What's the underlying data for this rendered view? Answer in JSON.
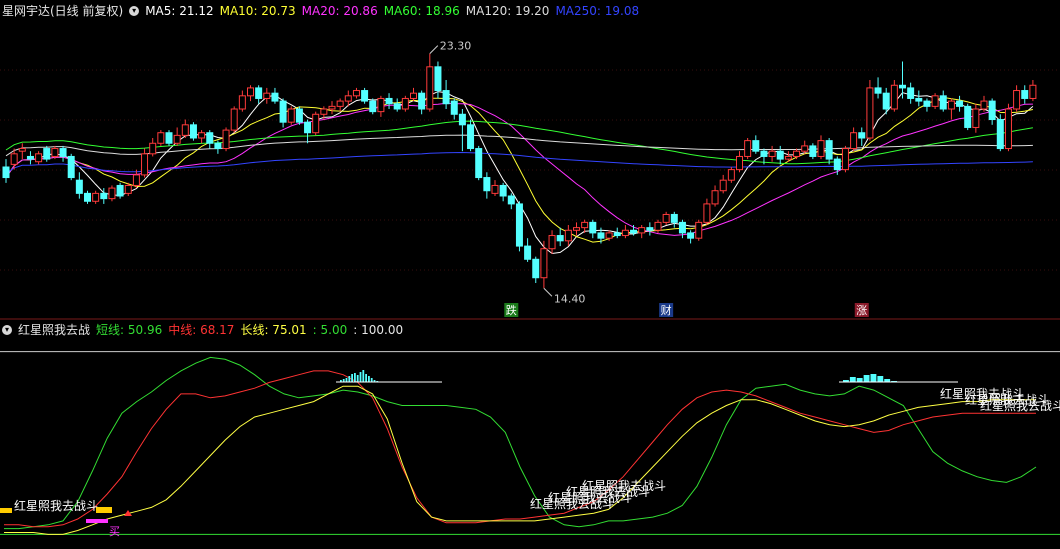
{
  "main_panel": {
    "title": "星网宇达(日线 前复权)",
    "toggle_icon": "chevron-down-icon",
    "indicators": [
      {
        "label": "MA5: 21.12",
        "color": "#ffffff"
      },
      {
        "label": "MA10: 20.73",
        "color": "#ffff33"
      },
      {
        "label": "MA20: 20.86",
        "color": "#ff33ff"
      },
      {
        "label": "MA60: 18.96",
        "color": "#33ff33"
      },
      {
        "label": "MA120: 19.20",
        "color": "#dcdcdc"
      },
      {
        "label": "MA250: 19.08",
        "color": "#3344ff"
      }
    ],
    "high_label": "23.30",
    "low_label": "14.40",
    "markers": [
      {
        "text": "跌",
        "bg": "#1a7a1a"
      },
      {
        "text": "财",
        "bg": "#1a3a8a"
      },
      {
        "text": "涨",
        "bg": "#8a1a2a"
      }
    ]
  },
  "sub_panel": {
    "title": "红星照我去战",
    "indicators": [
      {
        "label": "短线: 50.96",
        "color": "#33dd33"
      },
      {
        "label": "中线: 68.17",
        "color": "#ff3333"
      },
      {
        "label": "长线: 75.01",
        "color": "#ffff44"
      },
      {
        "label": ": 5.00",
        "color": "#33dd33"
      },
      {
        "label": ": 100.00",
        "color": "#e6e6e6"
      }
    ],
    "annotation": "红星照我去战斗",
    "buy_mark": "买"
  },
  "chart_data": [
    {
      "type": "candlestick",
      "title": "星网宇达(日线 前复权)",
      "ylim": [
        13.5,
        24.5
      ],
      "price_high": 23.3,
      "price_low": 14.4,
      "bars": [
        [
          19.0,
          18.6,
          19.3,
          18.4
        ],
        [
          19.1,
          19.5,
          19.7,
          18.9
        ],
        [
          19.6,
          19.7,
          19.9,
          19.3
        ],
        [
          19.4,
          19.3,
          19.6,
          19.1
        ],
        [
          19.2,
          19.5,
          19.6,
          19.1
        ],
        [
          19.7,
          19.3,
          19.8,
          19.2
        ],
        [
          19.4,
          19.7,
          19.8,
          19.3
        ],
        [
          19.7,
          19.4,
          19.8,
          19.2
        ],
        [
          19.4,
          18.6,
          19.5,
          18.5
        ],
        [
          18.5,
          18.0,
          18.8,
          17.8
        ],
        [
          18.0,
          17.7,
          18.1,
          17.6
        ],
        [
          17.7,
          18.0,
          18.1,
          17.6
        ],
        [
          18.0,
          17.8,
          18.2,
          17.6
        ],
        [
          17.8,
          18.2,
          18.3,
          17.7
        ],
        [
          18.3,
          17.9,
          18.4,
          17.8
        ],
        [
          18.0,
          18.3,
          18.4,
          17.9
        ],
        [
          18.3,
          18.7,
          18.9,
          18.2
        ],
        [
          18.7,
          19.5,
          19.7,
          18.6
        ],
        [
          19.5,
          19.9,
          20.1,
          19.4
        ],
        [
          19.9,
          20.3,
          20.4,
          19.8
        ],
        [
          20.3,
          19.9,
          20.4,
          19.8
        ],
        [
          19.9,
          20.2,
          20.5,
          19.8
        ],
        [
          20.2,
          20.6,
          20.8,
          20.1
        ],
        [
          20.6,
          20.1,
          20.7,
          20.0
        ],
        [
          20.1,
          20.3,
          20.4,
          19.9
        ],
        [
          20.3,
          19.9,
          20.4,
          19.7
        ],
        [
          19.9,
          19.7,
          20.0,
          19.5
        ],
        [
          19.7,
          20.4,
          20.5,
          19.6
        ],
        [
          20.4,
          21.2,
          21.3,
          20.3
        ],
        [
          21.2,
          21.7,
          21.9,
          21.1
        ],
        [
          21.7,
          22.0,
          22.1,
          21.5
        ],
        [
          22.0,
          21.6,
          22.1,
          21.4
        ],
        [
          21.6,
          21.8,
          22.0,
          21.4
        ],
        [
          21.8,
          21.5,
          22.0,
          21.4
        ],
        [
          21.5,
          20.7,
          21.6,
          20.5
        ],
        [
          20.7,
          21.2,
          21.3,
          20.6
        ],
        [
          21.2,
          20.7,
          21.3,
          20.6
        ],
        [
          20.7,
          20.3,
          20.8,
          19.9
        ],
        [
          20.3,
          21.0,
          21.1,
          20.2
        ],
        [
          21.0,
          21.2,
          21.3,
          20.8
        ],
        [
          21.2,
          21.3,
          21.5,
          21.0
        ],
        [
          21.3,
          21.5,
          21.6,
          21.1
        ],
        [
          21.5,
          21.7,
          21.9,
          21.3
        ],
        [
          21.7,
          21.9,
          22.0,
          21.6
        ],
        [
          21.9,
          21.5,
          22.0,
          21.4
        ],
        [
          21.5,
          21.1,
          21.6,
          21.0
        ],
        [
          21.1,
          21.6,
          21.7,
          20.9
        ],
        [
          21.6,
          21.4,
          21.8,
          21.2
        ],
        [
          21.4,
          21.2,
          21.6,
          21.1
        ],
        [
          21.2,
          21.6,
          21.7,
          21.1
        ],
        [
          21.6,
          21.8,
          22.0,
          21.5
        ],
        [
          21.8,
          21.2,
          21.9,
          21.0
        ],
        [
          21.2,
          22.8,
          23.3,
          21.1
        ],
        [
          22.8,
          21.9,
          23.0,
          21.6
        ],
        [
          21.9,
          21.4,
          22.3,
          21.2
        ],
        [
          21.5,
          21.0,
          21.6,
          20.8
        ],
        [
          21.0,
          20.6,
          21.2,
          19.6
        ],
        [
          20.6,
          19.7,
          20.8,
          19.6
        ],
        [
          19.7,
          18.6,
          19.8,
          18.5
        ],
        [
          18.6,
          18.1,
          18.8,
          17.8
        ],
        [
          18.0,
          18.3,
          18.5,
          17.9
        ],
        [
          18.3,
          17.9,
          18.4,
          17.7
        ],
        [
          17.9,
          17.6,
          18.0,
          17.4
        ],
        [
          17.6,
          16.0,
          17.7,
          15.8
        ],
        [
          16.0,
          15.5,
          16.3,
          15.4
        ],
        [
          15.5,
          14.8,
          15.6,
          14.6
        ],
        [
          14.8,
          15.9,
          16.2,
          14.4
        ],
        [
          15.9,
          16.4,
          16.6,
          15.7
        ],
        [
          16.4,
          16.2,
          16.7,
          16.0
        ],
        [
          16.2,
          16.6,
          16.8,
          16.0
        ],
        [
          16.6,
          16.7,
          16.9,
          16.4
        ],
        [
          16.7,
          16.9,
          17.0,
          16.5
        ],
        [
          16.9,
          16.5,
          17.0,
          16.3
        ],
        [
          16.5,
          16.3,
          16.7,
          16.1
        ],
        [
          16.3,
          16.5,
          16.6,
          16.2
        ],
        [
          16.5,
          16.4,
          16.7,
          16.3
        ],
        [
          16.4,
          16.6,
          16.8,
          16.3
        ],
        [
          16.6,
          16.5,
          16.8,
          16.4
        ],
        [
          16.5,
          16.7,
          16.8,
          16.3
        ],
        [
          16.7,
          16.6,
          16.9,
          16.4
        ],
        [
          16.6,
          16.9,
          17.0,
          16.5
        ],
        [
          16.9,
          17.2,
          17.3,
          16.8
        ],
        [
          17.2,
          16.9,
          17.3,
          16.7
        ],
        [
          16.9,
          16.5,
          17.0,
          16.3
        ],
        [
          16.5,
          16.3,
          16.6,
          16.1
        ],
        [
          16.3,
          16.9,
          17.0,
          16.2
        ],
        [
          16.9,
          17.6,
          17.8,
          16.8
        ],
        [
          17.6,
          18.1,
          18.3,
          17.5
        ],
        [
          18.1,
          18.5,
          18.7,
          18.0
        ],
        [
          18.5,
          18.9,
          19.0,
          18.4
        ],
        [
          18.9,
          19.4,
          19.6,
          18.8
        ],
        [
          19.4,
          20.0,
          20.1,
          19.3
        ],
        [
          20.0,
          19.6,
          20.2,
          19.5
        ],
        [
          19.6,
          19.4,
          19.7,
          19.1
        ],
        [
          19.4,
          19.6,
          19.8,
          19.2
        ],
        [
          19.6,
          19.3,
          19.8,
          19.1
        ],
        [
          19.3,
          19.4,
          19.6,
          19.2
        ],
        [
          19.4,
          19.6,
          19.7,
          19.3
        ],
        [
          19.6,
          19.8,
          20.0,
          19.5
        ],
        [
          19.8,
          19.4,
          19.9,
          19.3
        ],
        [
          19.4,
          20.0,
          20.2,
          19.3
        ],
        [
          20.0,
          19.3,
          20.1,
          19.1
        ],
        [
          19.3,
          18.9,
          19.4,
          18.7
        ],
        [
          18.9,
          19.7,
          19.8,
          18.8
        ],
        [
          19.7,
          20.3,
          20.5,
          19.6
        ],
        [
          20.3,
          20.1,
          20.5,
          19.8
        ],
        [
          20.1,
          22.0,
          22.3,
          20.0
        ],
        [
          22.0,
          21.8,
          22.4,
          21.6
        ],
        [
          21.8,
          21.2,
          22.0,
          21.0
        ],
        [
          21.2,
          22.1,
          22.3,
          21.1
        ],
        [
          22.1,
          22.0,
          23.0,
          21.6
        ],
        [
          22.0,
          21.6,
          22.2,
          21.4
        ],
        [
          21.6,
          21.5,
          21.9,
          21.3
        ],
        [
          21.5,
          21.3,
          21.6,
          21.1
        ],
        [
          21.3,
          21.7,
          21.8,
          21.2
        ],
        [
          21.7,
          21.2,
          21.9,
          21.1
        ],
        [
          21.2,
          21.5,
          21.6,
          20.8
        ],
        [
          21.5,
          21.3,
          21.7,
          21.1
        ],
        [
          21.3,
          20.5,
          21.4,
          20.4
        ],
        [
          20.5,
          21.2,
          21.4,
          20.3
        ],
        [
          21.2,
          21.5,
          21.7,
          21.1
        ],
        [
          21.5,
          20.8,
          21.6,
          20.6
        ],
        [
          20.8,
          19.7,
          21.0,
          19.6
        ],
        [
          19.7,
          21.2,
          21.4,
          19.6
        ],
        [
          21.2,
          21.9,
          22.1,
          21.1
        ],
        [
          21.9,
          21.6,
          22.1,
          21.4
        ],
        [
          21.6,
          22.1,
          22.3,
          21.5
        ]
      ],
      "series": [
        {
          "name": "MA5",
          "color": "#ffffff"
        },
        {
          "name": "MA10",
          "color": "#ffff33"
        },
        {
          "name": "MA20",
          "color": "#ff33ff"
        },
        {
          "name": "MA60",
          "color": "#33ff33"
        },
        {
          "name": "MA120",
          "color": "#dcdcdc"
        },
        {
          "name": "MA250",
          "color": "#3344ff"
        }
      ]
    },
    {
      "type": "line",
      "title": "红星照我去战",
      "ylim": [
        0,
        105
      ],
      "reference_lines": [
        5,
        100
      ],
      "series": [
        {
          "name": "短线",
          "color": "#33dd33",
          "values": [
            8,
            8,
            9,
            10,
            12,
            22,
            38,
            55,
            68,
            74,
            79,
            85,
            90,
            94,
            97,
            96,
            93,
            88,
            82,
            78,
            76,
            77,
            78,
            80,
            79,
            77,
            74,
            72,
            72,
            72,
            72,
            71,
            70,
            66,
            58,
            40,
            25,
            14,
            10,
            9,
            10,
            12,
            12,
            13,
            14,
            16,
            20,
            30,
            45,
            62,
            75,
            81,
            82,
            83,
            80,
            78,
            77,
            78,
            82,
            80,
            76,
            72,
            60,
            48,
            42,
            38,
            35,
            33,
            32,
            35,
            40
          ]
        },
        {
          "name": "中线",
          "color": "#ff3333",
          "values": [
            10,
            10,
            9,
            9,
            10,
            13,
            18,
            26,
            35,
            48,
            60,
            70,
            78,
            78,
            76,
            77,
            79,
            81,
            84,
            86,
            88,
            90,
            90,
            88,
            84,
            76,
            60,
            40,
            24,
            14,
            11,
            11,
            11,
            12,
            13,
            13,
            14,
            15,
            16,
            19,
            22,
            28,
            35,
            44,
            53,
            62,
            70,
            76,
            79,
            80,
            79,
            77,
            74,
            71,
            68,
            66,
            64,
            62,
            60,
            58,
            59,
            62,
            64,
            66,
            67,
            68,
            68,
            68,
            68,
            68,
            68
          ]
        },
        {
          "name": "长线",
          "color": "#ffff44",
          "values": [
            6,
            6,
            6,
            5,
            5,
            7,
            10,
            13,
            15,
            17,
            19,
            23,
            30,
            38,
            46,
            54,
            61,
            66,
            68,
            70,
            72,
            74,
            78,
            82,
            82,
            78,
            65,
            42,
            22,
            14,
            12,
            12,
            12,
            12,
            12,
            12,
            12,
            13,
            14,
            15,
            16,
            18,
            24,
            32,
            40,
            48,
            56,
            63,
            68,
            72,
            75,
            75,
            73,
            70,
            67,
            64,
            62,
            61,
            62,
            64,
            67,
            69,
            71,
            72,
            73,
            74,
            74,
            75,
            75,
            75,
            75
          ]
        }
      ]
    }
  ]
}
